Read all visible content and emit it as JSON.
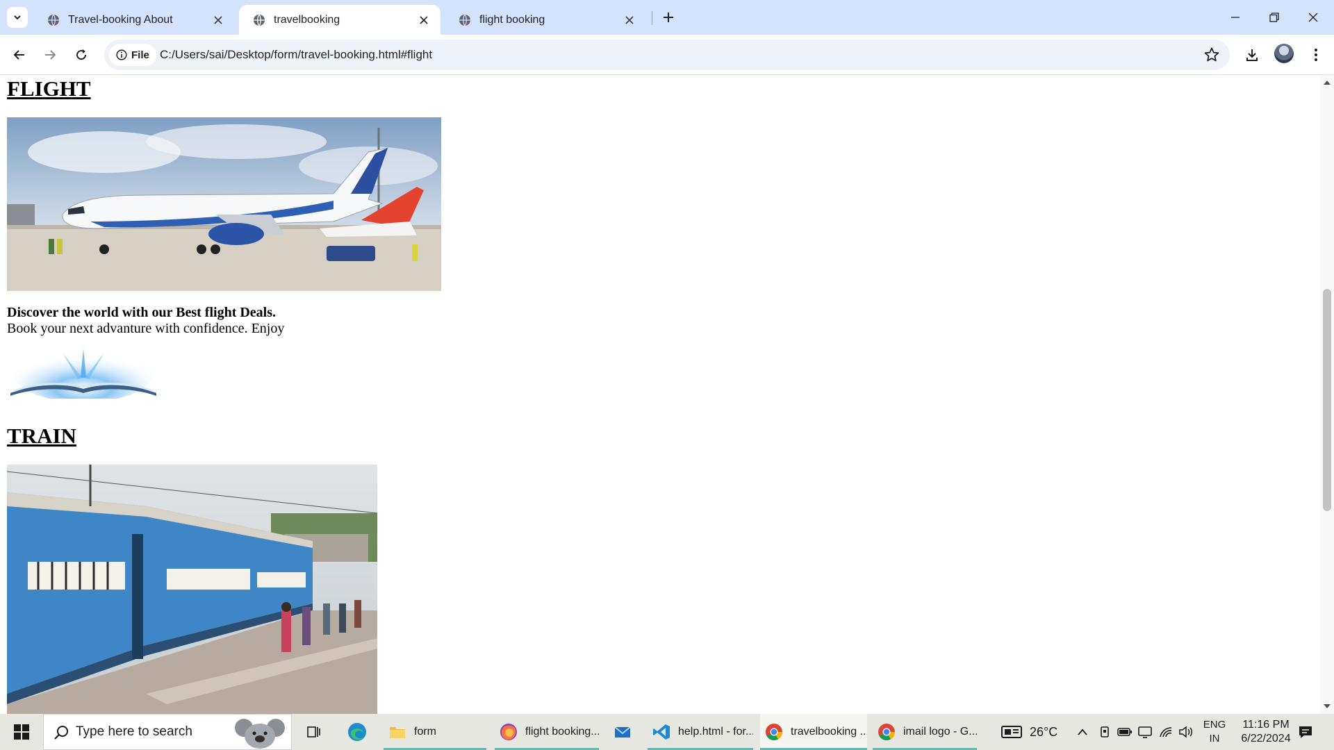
{
  "browser": {
    "tabs": [
      {
        "title": "Travel-booking About",
        "active": false
      },
      {
        "title": "travelbooking",
        "active": true
      },
      {
        "title": "flight booking",
        "active": false
      }
    ],
    "address_chip": "File",
    "url": "C:/Users/sai/Desktop/form/travel-booking.html#flight"
  },
  "page": {
    "flight_heading": "FLIGHT",
    "promo_line1": "Discover the world with our Best flight Deals.",
    "promo_line2": "Book your next advanture with confidence. Enjoy",
    "train_heading": "TRAIN"
  },
  "taskbar": {
    "search_placeholder": "Type here to search",
    "apps": [
      {
        "label": "form",
        "icon": "folder-icon"
      },
      {
        "label": "flight booking...",
        "icon": "firefox-icon"
      },
      {
        "label": "",
        "icon": "mail-icon"
      },
      {
        "label": "help.html - for...",
        "icon": "vscode-icon"
      },
      {
        "label": "travelbooking ...",
        "icon": "chrome-icon"
      },
      {
        "label": "imail logo - G...",
        "icon": "chrome-icon"
      }
    ],
    "weather": "26°C",
    "language_line1": "ENG",
    "language_line2": "IN",
    "time": "11:16 PM",
    "date": "6/22/2024"
  },
  "colors": {
    "tabstrip_bg": "#d3e3fd",
    "taskbar_bg": "#e7e7e2",
    "running_indicator": "#50c0b8"
  }
}
